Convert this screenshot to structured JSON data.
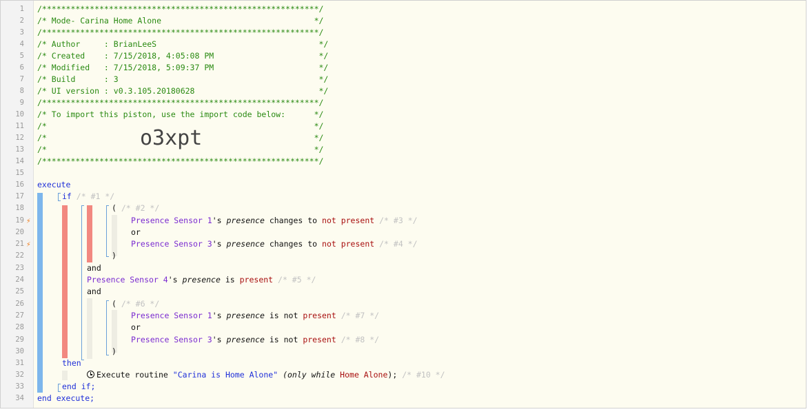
{
  "lines": [
    {
      "n": "1"
    },
    {
      "n": "2"
    },
    {
      "n": "3"
    },
    {
      "n": "4"
    },
    {
      "n": "5"
    },
    {
      "n": "6"
    },
    {
      "n": "7"
    },
    {
      "n": "8"
    },
    {
      "n": "9"
    },
    {
      "n": "10"
    },
    {
      "n": "11"
    },
    {
      "n": "12"
    },
    {
      "n": "13"
    },
    {
      "n": "14"
    },
    {
      "n": "15"
    },
    {
      "n": "16"
    },
    {
      "n": "17"
    },
    {
      "n": "18"
    },
    {
      "n": "19"
    },
    {
      "n": "20"
    },
    {
      "n": "21"
    },
    {
      "n": "22"
    },
    {
      "n": "23"
    },
    {
      "n": "24"
    },
    {
      "n": "25"
    },
    {
      "n": "26"
    },
    {
      "n": "27"
    },
    {
      "n": "28"
    },
    {
      "n": "29"
    },
    {
      "n": "30"
    },
    {
      "n": "31"
    },
    {
      "n": "32"
    },
    {
      "n": "33"
    },
    {
      "n": "34"
    }
  ],
  "header": {
    "l1": "/**********************************************************/",
    "l2": "/* Mode- Carina Home Alone                                */",
    "l3": "/**********************************************************/",
    "l4": "/* Author     : BrianLeeS                                  */",
    "l5": "/* Created    : 7/15/2018, 4:05:08 PM                      */",
    "l6": "/* Modified   : 7/15/2018, 5:09:37 PM                      */",
    "l7": "/* Build      : 3                                          */",
    "l8": "/* UI version : v0.3.105.20180628                          */",
    "l9": "/**********************************************************/",
    "l10": "/* To import this piston, use the import code below:      */",
    "l11": "/*                                                        */",
    "l12": "/*                                                        */",
    "l13": "/*                                                        */",
    "l14": "/**********************************************************/",
    "import_code": "o3xpt"
  },
  "code": {
    "execute": "execute",
    "if": "if",
    "c1": "/* #1 */",
    "paren_open": "(",
    "paren_close": ")",
    "c2": "/* #2 */",
    "c6": "/* #6 */",
    "dev1": "Presence Sensor 1",
    "dev3": "Presence Sensor 3",
    "dev4": "Presence Sensor 4",
    "poss": "'s",
    "attr": "presence",
    "changes_to": "changes to",
    "is": "is",
    "is_not": "is not",
    "not_present": "not present",
    "present": "present",
    "c3": "/* #3 */",
    "c4": "/* #4 */",
    "c5": "/* #5 */",
    "c7": "/* #7 */",
    "c8": "/* #8 */",
    "or": "or",
    "and": "and",
    "then": "then",
    "exec_routine": "Execute routine",
    "routine_name": "\"Carina is Home Alone\"",
    "only_while": "(only while",
    "mode_name": "Home Alone",
    "only_while_end": ");",
    "c10": "/* #10 */",
    "end_if": "end if;",
    "end_execute": "end execute;"
  },
  "colors": {
    "comment": "#2a8a12",
    "keyword": "#1f2fd8",
    "device": "#7a2bd0",
    "value": "#a80f0f",
    "faded_comment": "#c2c2c2",
    "block_blue": "#7db6ec",
    "block_red": "#f28880",
    "bolt": "#f07c18"
  },
  "icons": {
    "trigger": "lightning-bolt-icon",
    "timer": "clock-icon"
  }
}
